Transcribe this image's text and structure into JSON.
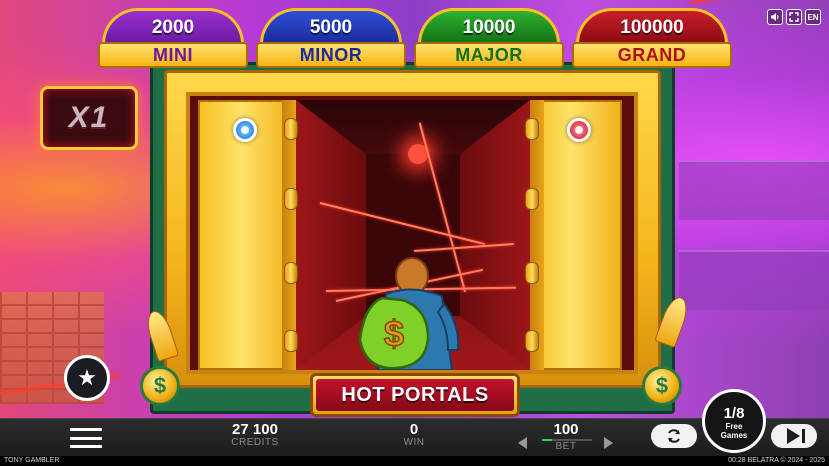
{
  "jackpots": [
    {
      "amount": "2000",
      "name": "MINI"
    },
    {
      "amount": "5000",
      "name": "MINOR"
    },
    {
      "amount": "10000",
      "name": "MAJOR"
    },
    {
      "amount": "100000",
      "name": "GRAND"
    }
  ],
  "system_buttons": {
    "sound_icon": "speaker-icon",
    "fullscreen_icon": "fullscreen-icon",
    "language": "EN"
  },
  "multiplier": "X1",
  "game_title": "HOT PORTALS",
  "character": {
    "bag_symbol": "$"
  },
  "coin_symbol": "$",
  "favorite_icon": "star-icon",
  "bottom_bar": {
    "credits_value": "27 100",
    "credits_label": "CREDITS",
    "win_value": "0",
    "win_label": "WIN",
    "bet_value": "100",
    "bet_label": "BET",
    "autospin_icon": "refresh-icon",
    "spin_icon": "play-skip-icon"
  },
  "free_games": {
    "count": "1/8",
    "label_line1": "Free",
    "label_line2": "Games"
  },
  "footer": {
    "game_name": "TONY GAMBLER",
    "time": "00:28",
    "copyright": "BELATRA © 2024 - 2025"
  },
  "colors": {
    "mini": "#6a1aa0",
    "minor": "#1a2a9a",
    "major": "#137016",
    "grand": "#b0101c",
    "frame_green": "#1f6e46",
    "gold": "#f4b51c"
  }
}
